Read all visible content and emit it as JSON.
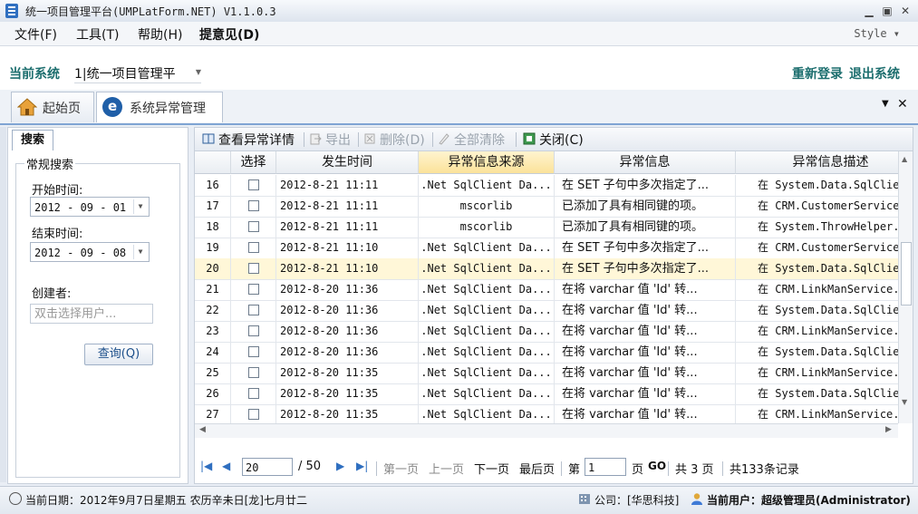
{
  "window": {
    "title": "统一项目管理平台(UMPLatForm.NET) V1.1.0.3"
  },
  "menu": {
    "items": [
      "文件(F)",
      "工具(T)",
      "帮助(H)",
      "提意见(D)"
    ],
    "style": "Style ▾"
  },
  "system": {
    "label": "当前系统",
    "value": "1|统一项目管理平",
    "relogin": "重新登录",
    "logout": "退出系统"
  },
  "tabs": [
    {
      "label": "起始页"
    },
    {
      "label": "系统异常管理"
    }
  ],
  "search": {
    "tab": "搜索",
    "group": "常规搜索",
    "start_label": "开始时间:",
    "start_value": "2012 - 09 - 01",
    "end_label": "结束时间:",
    "end_value": "2012 - 09 - 08",
    "creator_label": "创建者:",
    "creator_placeholder": "双击选择用户...",
    "query_button": "查询(Q)"
  },
  "toolbar": {
    "view": "查看异常详情",
    "export": "导出",
    "delete": "删除(D)",
    "clear": "全部清除",
    "close": "关闭(C)"
  },
  "grid": {
    "headers": [
      "选择",
      "发生时间",
      "异常信息来源",
      "异常信息",
      "异常信息描述"
    ],
    "rows": [
      {
        "no": "16",
        "time": "2012-8-21 11:11",
        "source": ".Net SqlClient Da...",
        "msg": "在 SET 子句中多次指定了...",
        "desc": "在 System.Data.SqlClie"
      },
      {
        "no": "17",
        "time": "2012-8-21 11:11",
        "source": "mscorlib",
        "msg": "已添加了具有相同键的项。",
        "desc": "在 CRM.CustomerService"
      },
      {
        "no": "18",
        "time": "2012-8-21 11:11",
        "source": "mscorlib",
        "msg": "已添加了具有相同键的项。",
        "desc": "在 System.ThrowHelper."
      },
      {
        "no": "19",
        "time": "2012-8-21 11:10",
        "source": ".Net SqlClient Da...",
        "msg": "在 SET 子句中多次指定了...",
        "desc": "在 CRM.CustomerService"
      },
      {
        "no": "20",
        "time": "2012-8-21 11:10",
        "source": ".Net SqlClient Da...",
        "msg": "在 SET 子句中多次指定了...",
        "desc": "在 System.Data.SqlClie"
      },
      {
        "no": "21",
        "time": "2012-8-20 11:36",
        "source": ".Net SqlClient Da...",
        "msg": "在将 varchar 值 'Id' 转...",
        "desc": "在 CRM.LinkManService."
      },
      {
        "no": "22",
        "time": "2012-8-20 11:36",
        "source": ".Net SqlClient Da...",
        "msg": "在将 varchar 值 'Id' 转...",
        "desc": "在 System.Data.SqlClie"
      },
      {
        "no": "23",
        "time": "2012-8-20 11:36",
        "source": ".Net SqlClient Da...",
        "msg": "在将 varchar 值 'Id' 转...",
        "desc": "在 CRM.LinkManService."
      },
      {
        "no": "24",
        "time": "2012-8-20 11:36",
        "source": ".Net SqlClient Da...",
        "msg": "在将 varchar 值 'Id' 转...",
        "desc": "在 System.Data.SqlClie"
      },
      {
        "no": "25",
        "time": "2012-8-20 11:35",
        "source": ".Net SqlClient Da...",
        "msg": "在将 varchar 值 'Id' 转...",
        "desc": "在 CRM.LinkManService."
      },
      {
        "no": "26",
        "time": "2012-8-20 11:35",
        "source": ".Net SqlClient Da...",
        "msg": "在将 varchar 值 'Id' 转...",
        "desc": "在 System.Data.SqlClie"
      },
      {
        "no": "27",
        "time": "2012-8-20 11:35",
        "source": ".Net SqlClient Da...",
        "msg": "在将 varchar 值 'Id' 转...",
        "desc": "在 CRM.LinkManService."
      }
    ],
    "selected_row": "20"
  },
  "pager": {
    "page_size": "20",
    "of": "/ 50",
    "first": "第一页",
    "prev": "上一页",
    "next": "下一页",
    "last": "最后页",
    "goto_prefix": "第",
    "goto_value": "1",
    "goto_suffix": "页",
    "go": "GO",
    "total_pages": "共 3 页",
    "total_records": "共133条记录"
  },
  "statusbar": {
    "date": "当前日期：2012年9月7日星期五  农历辛未日[龙]七月廿二",
    "company": "公司：[华思科技]",
    "user": "当前用户：超级管理员(Administrator)"
  },
  "colors": {
    "accent": "#1c6e6e",
    "selected_row": "#fff7d8",
    "header_selected": "#fbe29a"
  }
}
